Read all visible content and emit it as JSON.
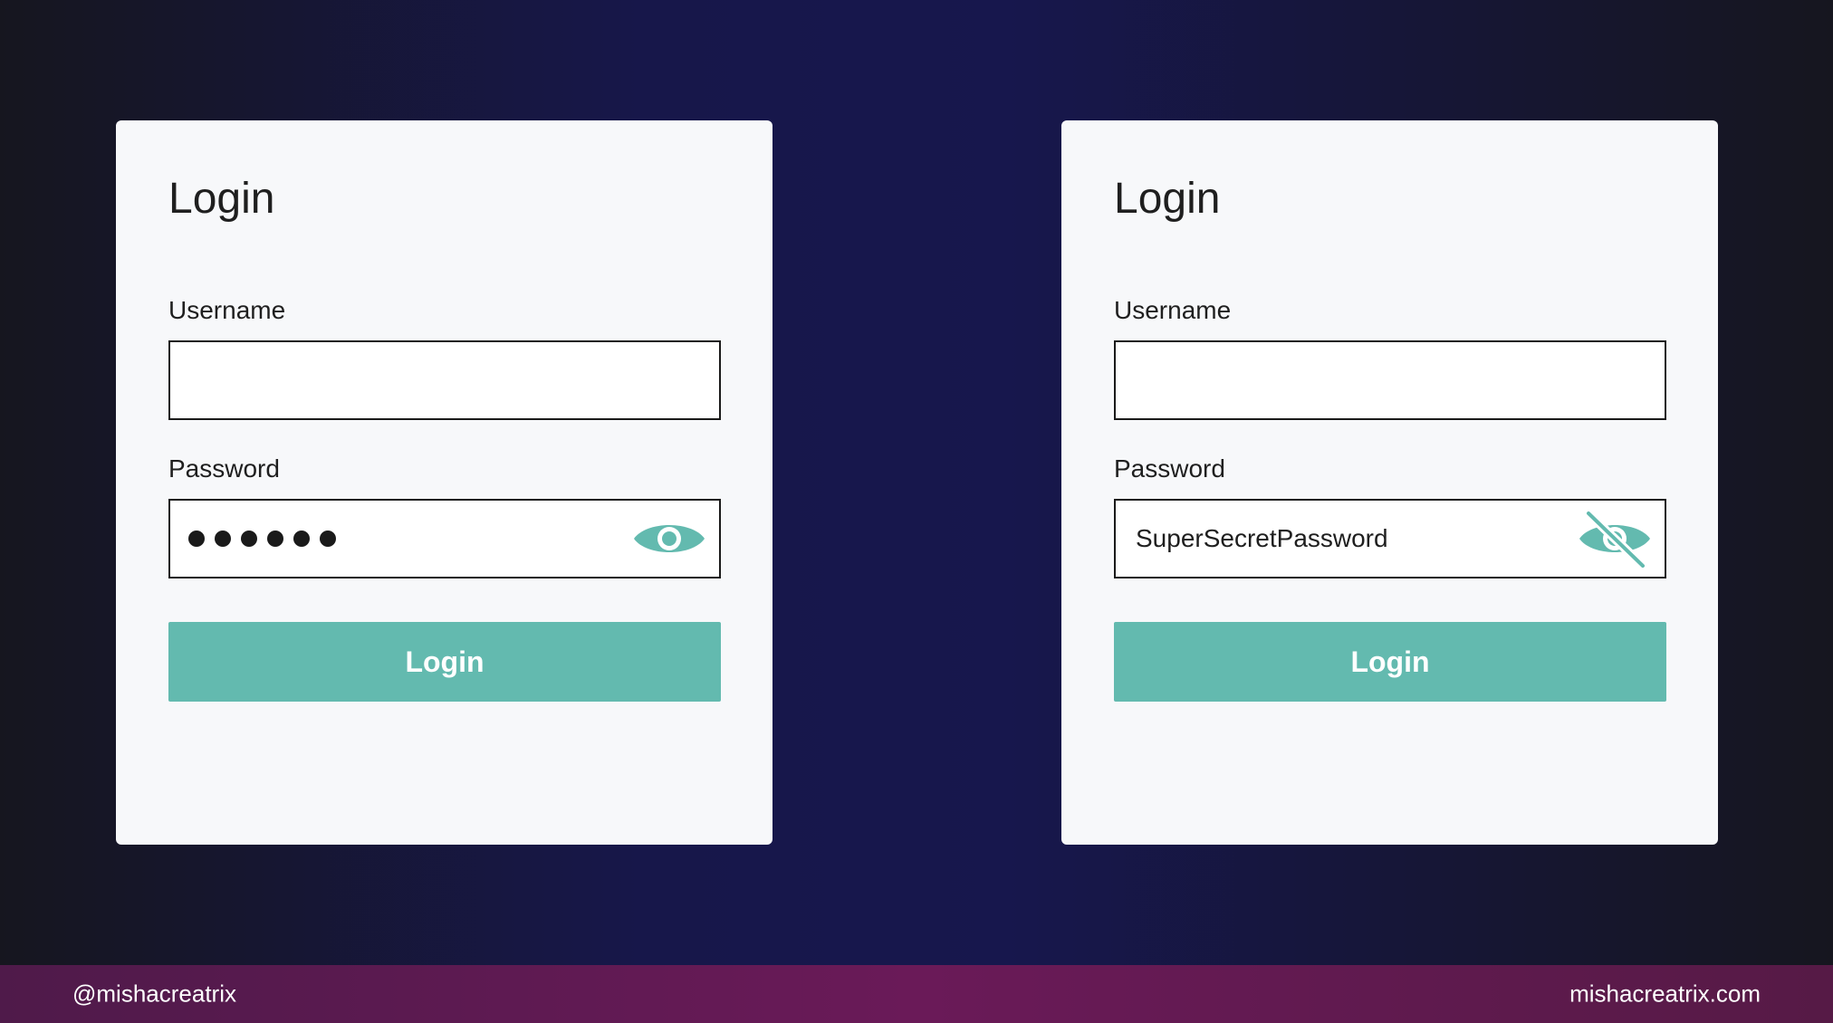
{
  "login_before": {
    "title": "Login",
    "username_label": "Username",
    "username_value": "",
    "password_label": "Password",
    "password_masked_length": 6,
    "password_visible": false,
    "toggle_icon": "eye-icon",
    "button_label": "Login"
  },
  "login_after": {
    "title": "Login",
    "username_label": "Username",
    "username_value": "",
    "password_label": "Password",
    "password_value": "SuperSecretPassword",
    "password_visible": true,
    "toggle_icon": "eye-slash-icon",
    "button_label": "Login"
  },
  "footer": {
    "handle": "@mishacreatrix",
    "website": "mishacreatrix.com"
  },
  "colors": {
    "accent": "#63baaf",
    "card_background": "#f7f8fa",
    "footer_gradient": [
      "#4f1a4a",
      "#6a1a58",
      "#561a46"
    ]
  }
}
